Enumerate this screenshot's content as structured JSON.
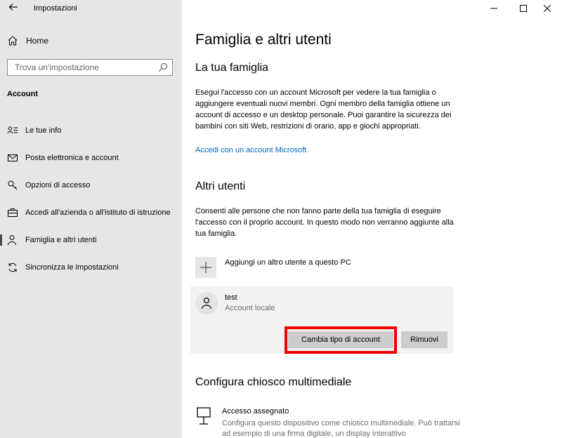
{
  "window": {
    "title": "Impostazioni",
    "back_icon": "arrow-left-icon",
    "controls": [
      "minimize-icon",
      "maximize-icon",
      "close-icon"
    ]
  },
  "sidebar": {
    "home_label": "Home",
    "search_placeholder": "Trova un'impostazione",
    "section_label": "Account",
    "items": [
      {
        "label": "Le tue info",
        "icon": "user-info-icon"
      },
      {
        "label": "Posta elettronica e account",
        "icon": "mail-icon"
      },
      {
        "label": "Opzioni di accesso",
        "icon": "key-icon"
      },
      {
        "label": "Accedi all'azienda o all'istituto di istruzione",
        "icon": "briefcase-icon"
      },
      {
        "label": "Famiglia e altri utenti",
        "icon": "person-icon",
        "selected": true
      },
      {
        "label": "Sincronizza le impostazioni",
        "icon": "sync-icon"
      }
    ]
  },
  "main": {
    "title": "Famiglia e altri utenti",
    "family": {
      "heading": "La tua famiglia",
      "description": "Esegui l'accesso con un account Microsoft per vedere la tua famiglia o aggiungere eventuali nuovi membri. Ogni membro della famiglia ottiene un account di accesso e un desktop personale. Puoi garantire la sicurezza dei bambini con siti Web, restrizioni di orario, app e giochi appropriati.",
      "link": "Accedi con un account Microsoft"
    },
    "others": {
      "heading": "Altri utenti",
      "description": "Consenti alle persone che non fanno parte della tua famiglia di eseguire l'accesso con il proprio account. In questo modo non verranno aggiunte alla tua famiglia.",
      "add_label": "Aggiungi un altro utente a questo PC",
      "user": {
        "name": "test",
        "type": "Account locale",
        "change_button": "Cambia tipo di account",
        "remove_button": "Rimuovi"
      }
    },
    "kiosk": {
      "heading": "Configura chiosco multimediale",
      "title": "Accesso assegnato",
      "description": "Configura questo dispositivo come chiosco multimediale. Può trattarsi ad esempio di una firma digitale, un display interattivo"
    }
  },
  "colors": {
    "sidebar_bg": "#e6e6e6",
    "link": "#0067c0",
    "highlight": "#f00000",
    "button": "#cccccc"
  }
}
